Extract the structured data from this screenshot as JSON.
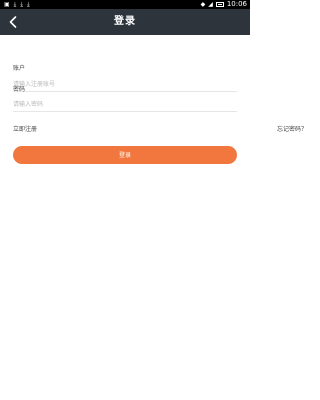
{
  "status_bar": {
    "left_icons": [
      "app-icon",
      "download-icon",
      "download-icon",
      "download-icon"
    ],
    "right_icons": [
      "wifi-icon",
      "signal-icon",
      "battery-icon"
    ],
    "time": "10:06"
  },
  "header": {
    "title": "登录",
    "background": "#2d343c"
  },
  "form": {
    "account": {
      "label": "账户",
      "placeholder": "请输入注册账号",
      "value": ""
    },
    "password": {
      "label": "密码",
      "placeholder": "请输入密码",
      "value": ""
    },
    "register_link": "立即注册",
    "forgot_link": "忘记密码？",
    "login_button": "登录",
    "accent_color": "#f2773e"
  }
}
